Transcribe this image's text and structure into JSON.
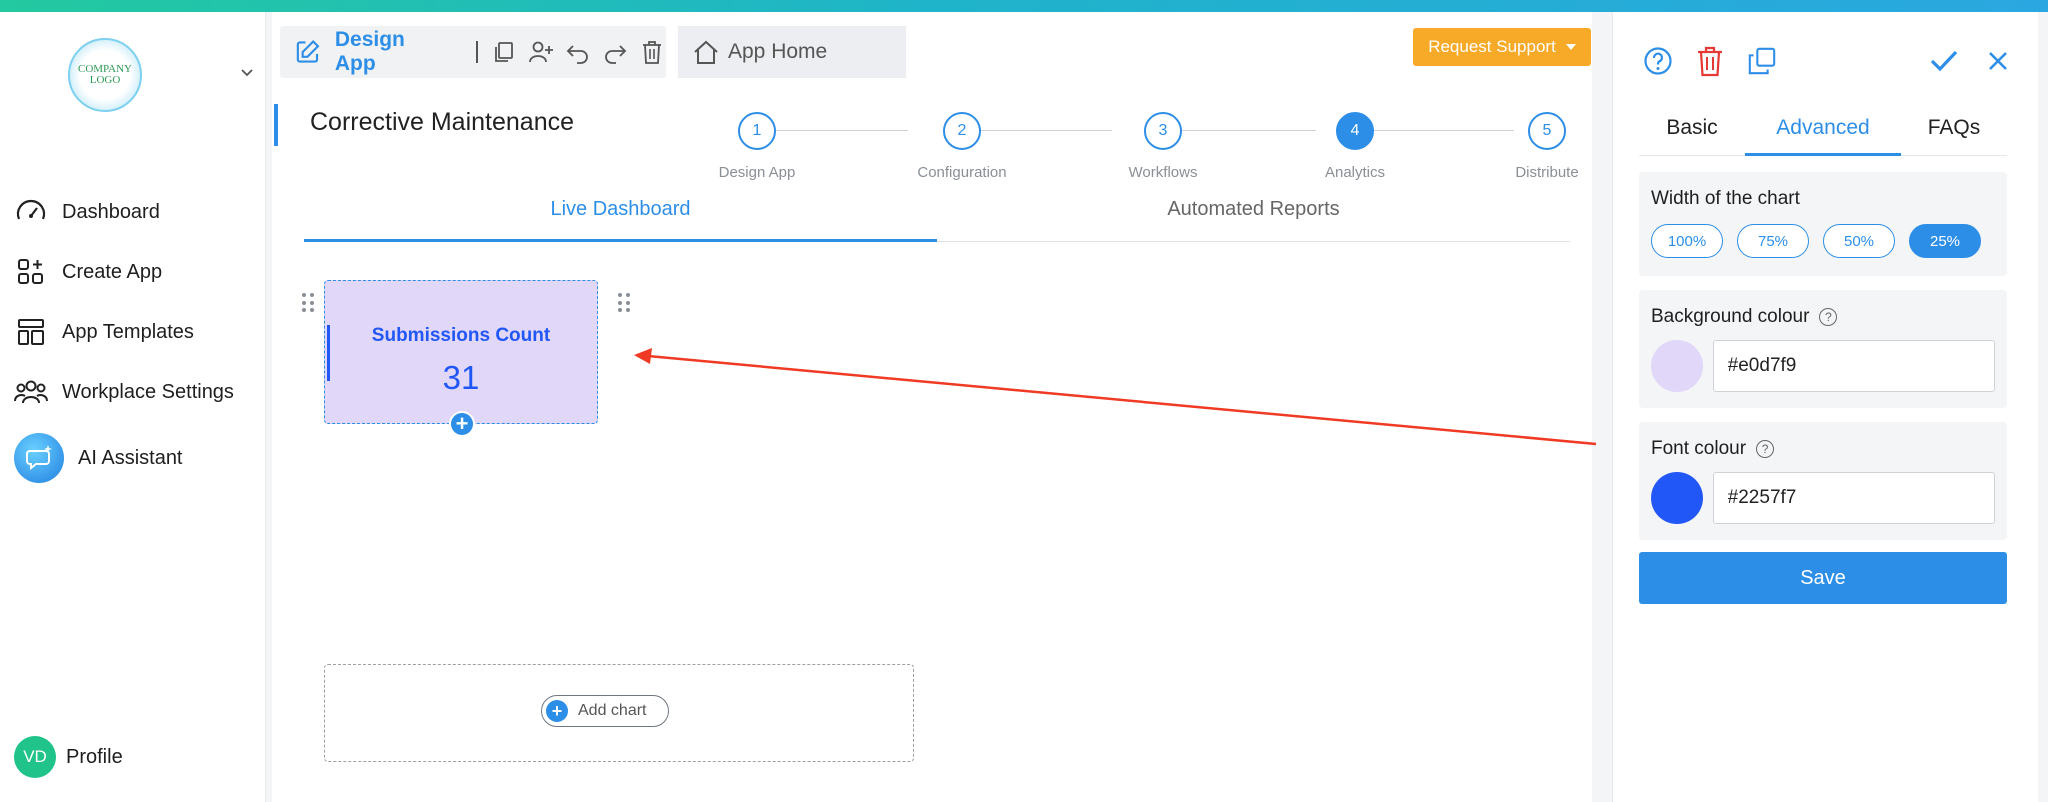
{
  "sidebar": {
    "logo_text": "COMPANY LOGO",
    "items": [
      {
        "label": "Dashboard",
        "icon": "gauge-icon"
      },
      {
        "label": "Create App",
        "icon": "grid-plus-icon"
      },
      {
        "label": "App Templates",
        "icon": "layout-icon"
      },
      {
        "label": "Workplace Settings",
        "icon": "users-icon"
      },
      {
        "label": "AI Assistant",
        "icon": "chat-sparkle-icon"
      }
    ],
    "profile": {
      "initials": "VD",
      "label": "Profile"
    }
  },
  "header": {
    "design_tab": "Design App",
    "home_tab": "App Home",
    "support_button": "Request Support"
  },
  "page": {
    "title": "Corrective Maintenance",
    "steps": [
      {
        "number": "1",
        "label": "Design App"
      },
      {
        "number": "2",
        "label": "Configuration"
      },
      {
        "number": "3",
        "label": "Workflows"
      },
      {
        "number": "4",
        "label": "Analytics",
        "active": true
      },
      {
        "number": "5",
        "label": "Distribute"
      }
    ],
    "tabs": [
      "Live Dashboard",
      "Automated Reports"
    ],
    "active_tab": "Live Dashboard"
  },
  "dashboard": {
    "card": {
      "title": "Submissions Count",
      "value": "31",
      "background": "#e0d7f9",
      "font_color": "#2257f7"
    },
    "add_chart_label": "Add chart"
  },
  "panel": {
    "tabs": [
      "Basic",
      "Advanced",
      "FAQs"
    ],
    "active_tab": "Advanced",
    "width_label": "Width of the chart",
    "width_options": [
      "100%",
      "75%",
      "50%",
      "25%"
    ],
    "width_selected": "25%",
    "background_label": "Background colour",
    "background_value": "#e0d7f9",
    "font_label": "Font colour",
    "font_value": "#2257f7",
    "save_label": "Save"
  },
  "colors": {
    "accent": "#2d8ee8",
    "support": "#f7a928",
    "delete": "#e53935",
    "arrow": "#f03a24"
  }
}
